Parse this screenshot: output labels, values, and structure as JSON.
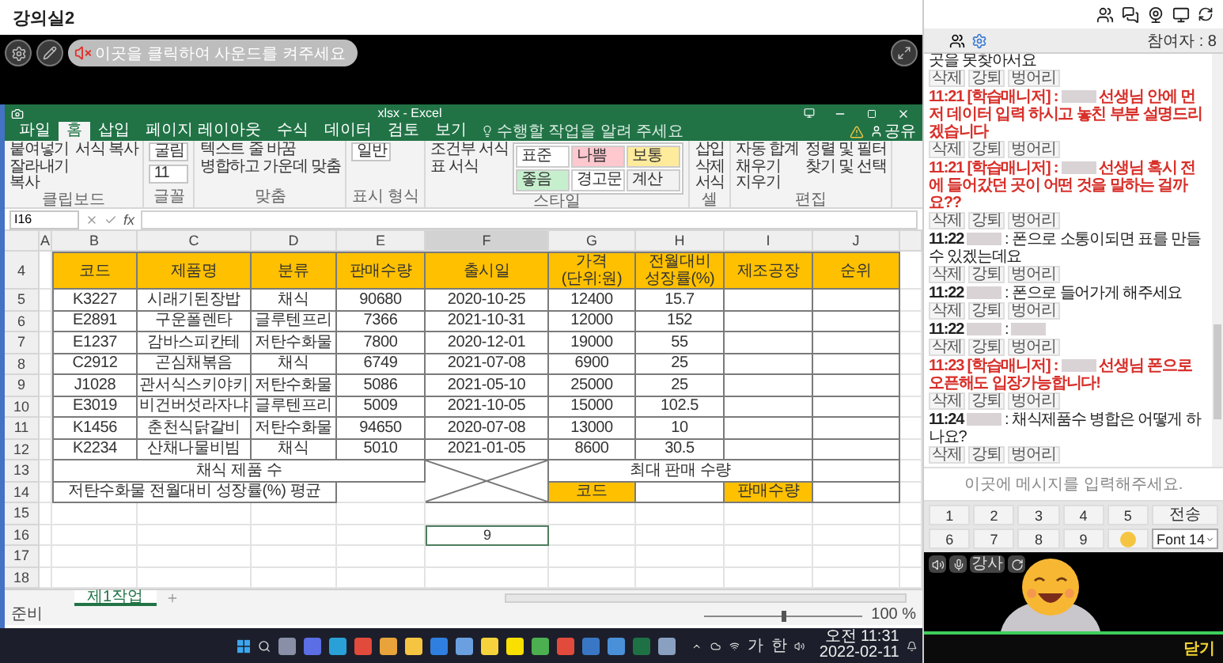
{
  "title": "강의실2",
  "sound_prompt": "이곳을 클릭하여 사운드를 켜주세요",
  "excel": {
    "window_title": "xlsx - Excel",
    "menu_tabs": [
      {
        "label": "파일",
        "selected": false
      },
      {
        "label": "홈",
        "selected": true
      },
      {
        "label": "삽입",
        "selected": false
      },
      {
        "label": "페이지 레이아웃",
        "selected": false
      },
      {
        "label": "수식",
        "selected": false
      },
      {
        "label": "데이터",
        "selected": false
      },
      {
        "label": "검토",
        "selected": false
      },
      {
        "label": "보기",
        "selected": false
      }
    ],
    "tell_me": "수행할 작업을 알려 주세요",
    "share": "공유",
    "ribbon": [
      {
        "label": "클립보드",
        "kind": "buttons",
        "items": [
          "붙여넣기",
          "잘라내기",
          "복사",
          "서식 복사"
        ]
      },
      {
        "label": "글꼴",
        "kind": "fields",
        "items": [
          "굴림",
          "11"
        ]
      },
      {
        "label": "맞춤",
        "kind": "buttons",
        "items": [
          "텍스트 줄 바꿈",
          "병합하고 가운데 맞춤"
        ]
      },
      {
        "label": "표시 형식",
        "kind": "fields",
        "items": [
          "일반"
        ]
      },
      {
        "label": "스타일",
        "kind": "styles",
        "items": [
          "조건부 서식",
          "표 서식"
        ],
        "styles": [
          {
            "label": "표준",
            "color": "#ffffff"
          },
          {
            "label": "나쁨",
            "color": "#ffc7ce"
          },
          {
            "label": "보통",
            "color": "#ffeb9c"
          },
          {
            "label": "좋음",
            "color": "#c6efce"
          },
          {
            "label": "경고문",
            "color": "#ffffff"
          },
          {
            "label": "계산",
            "color": "#f2f2f2"
          }
        ]
      },
      {
        "label": "셀",
        "kind": "buttons",
        "items": [
          "삽입",
          "삭제",
          "서식"
        ]
      },
      {
        "label": "편집",
        "kind": "buttons",
        "items": [
          "자동 합계",
          "채우기",
          "지우기",
          "정렬 및 필터",
          "찾기 및 선택"
        ]
      }
    ],
    "name_box": "I16",
    "function_label": "fx",
    "columns": [
      "A",
      "B",
      "C",
      "D",
      "E",
      "F",
      "G",
      "H",
      "I",
      "J"
    ],
    "header_row": {
      "number": "4",
      "cells": [
        "",
        "코드",
        "제품명",
        "분류",
        "판매수량",
        "출시일",
        "가격\n(단위:원)",
        "전월대비\n성장률(%)",
        "제조공장",
        "순위"
      ]
    },
    "rows": [
      {
        "number": "5",
        "cells": [
          "",
          "K3227",
          "시래기된장밥",
          "채식",
          "90680",
          "2020-10-25",
          "12400",
          "15.7"
        ]
      },
      {
        "number": "6",
        "cells": [
          "",
          "E2891",
          "구운폴렌타",
          "글루텐프리",
          "7366",
          "2021-10-31",
          "12000",
          "152"
        ]
      },
      {
        "number": "7",
        "cells": [
          "",
          "E1237",
          "감바스피칸테",
          "저탄수화물",
          "7800",
          "2020-12-01",
          "19000",
          "55"
        ]
      },
      {
        "number": "8",
        "cells": [
          "",
          "C2912",
          "곤심채볶음",
          "채식",
          "6749",
          "2021-07-08",
          "6900",
          "25"
        ]
      },
      {
        "number": "9",
        "cells": [
          "",
          "J1028",
          "관서식스키야키",
          "저탄수화물",
          "5086",
          "2021-05-10",
          "25000",
          "25"
        ]
      },
      {
        "number": "10",
        "cells": [
          "",
          "E3019",
          "비건버섯라자냐",
          "글루텐프리",
          "5009",
          "2021-10-05",
          "15000",
          "102.5"
        ]
      },
      {
        "number": "11",
        "cells": [
          "",
          "K1456",
          "춘천식닭갈비",
          "저탄수화물",
          "94650",
          "2020-07-08",
          "13000",
          "10"
        ]
      },
      {
        "number": "12",
        "cells": [
          "",
          "K2234",
          "산채나물비빔",
          "채식",
          "5010",
          "2021-01-05",
          "8600",
          "30.5"
        ]
      }
    ],
    "summary_rows": [
      {
        "number": "13",
        "cells": [
          {
            "text": "채식 제품 수",
            "highlighted": false
          },
          {
            "text": "최대 판매 수량",
            "highlighted": false
          }
        ]
      },
      {
        "number": "14",
        "cells": [
          {
            "text": "저탄수화물 전월대비 성장률(%) 평균",
            "highlighted": false
          },
          {
            "text": "코드",
            "highlighted": true
          },
          {
            "text": "판매수량",
            "highlighted": true
          }
        ]
      }
    ],
    "rows_below": [
      {
        "number": "15"
      },
      {
        "number": "16",
        "value": "9"
      },
      {
        "number": "17"
      },
      {
        "number": "18"
      }
    ],
    "sheet_tabs": [
      {
        "label": "제1작업",
        "selected": true
      }
    ],
    "status": "준비",
    "zoom_slider": {
      "level": 0.5
    },
    "zoom": "100 %"
  },
  "taskbar": {
    "tray_texts": [
      "가",
      "한"
    ],
    "time": "오전 11:31",
    "date": "2022-02-11"
  },
  "chat": {
    "participants": "참여자 : 8",
    "messages": [
      {
        "kind": "continued",
        "text": "곳을 못찾아서요",
        "actions": [
          "삭제",
          "강퇴",
          "벙어리"
        ]
      },
      {
        "kind": "manager",
        "time": "11:21",
        "role": "[학습매니저] :",
        "text": "선생님 안에 먼저 데이터 입력 하시고 놓친 부분 설명드리겠습니다",
        "actions": [
          "삭제",
          "강퇴",
          "벙어리"
        ]
      },
      {
        "kind": "manager",
        "time": "11:21",
        "role": "[학습매니저] :",
        "text": "선생님 혹시 전에 들어갔던 곳이 어떤 것을 말하는 걸까요??",
        "actions": [
          "삭제",
          "강퇴",
          "벙어리"
        ]
      },
      {
        "kind": "user",
        "time": "11:22",
        "text": ": 폰으로 소통이되면 표를 만들수 있겠는데요",
        "actions": [
          "삭제",
          "강퇴",
          "벙어리"
        ]
      },
      {
        "kind": "user",
        "time": "11:22",
        "text": ": 폰으로 들어가게 해주세요",
        "actions": [
          "삭제",
          "강퇴",
          "벙어리"
        ]
      },
      {
        "kind": "user_hidden",
        "time": "11:22",
        "text": ":",
        "actions": [
          "삭제",
          "강퇴",
          "벙어리"
        ]
      },
      {
        "kind": "manager",
        "time": "11:23",
        "role": "[학습매니저] :",
        "text": "선생님 폰으로 오픈해도 입장가능합니다!",
        "actions": [
          "삭제",
          "강퇴",
          "벙어리"
        ]
      },
      {
        "kind": "user",
        "time": "11:24",
        "text": ": 채식제품수 병합은 어떻게 하나요?",
        "actions": [
          "삭제",
          "강퇴",
          "벙어리"
        ]
      }
    ],
    "placeholder": "이곳에 메시지를 입력해주세요.",
    "keys": [
      "1",
      "2",
      "3",
      "4",
      "5",
      "6",
      "7",
      "8",
      "9"
    ],
    "send": "전송",
    "font_select": "Font 14",
    "video_label": "강사",
    "close": "닫기"
  }
}
